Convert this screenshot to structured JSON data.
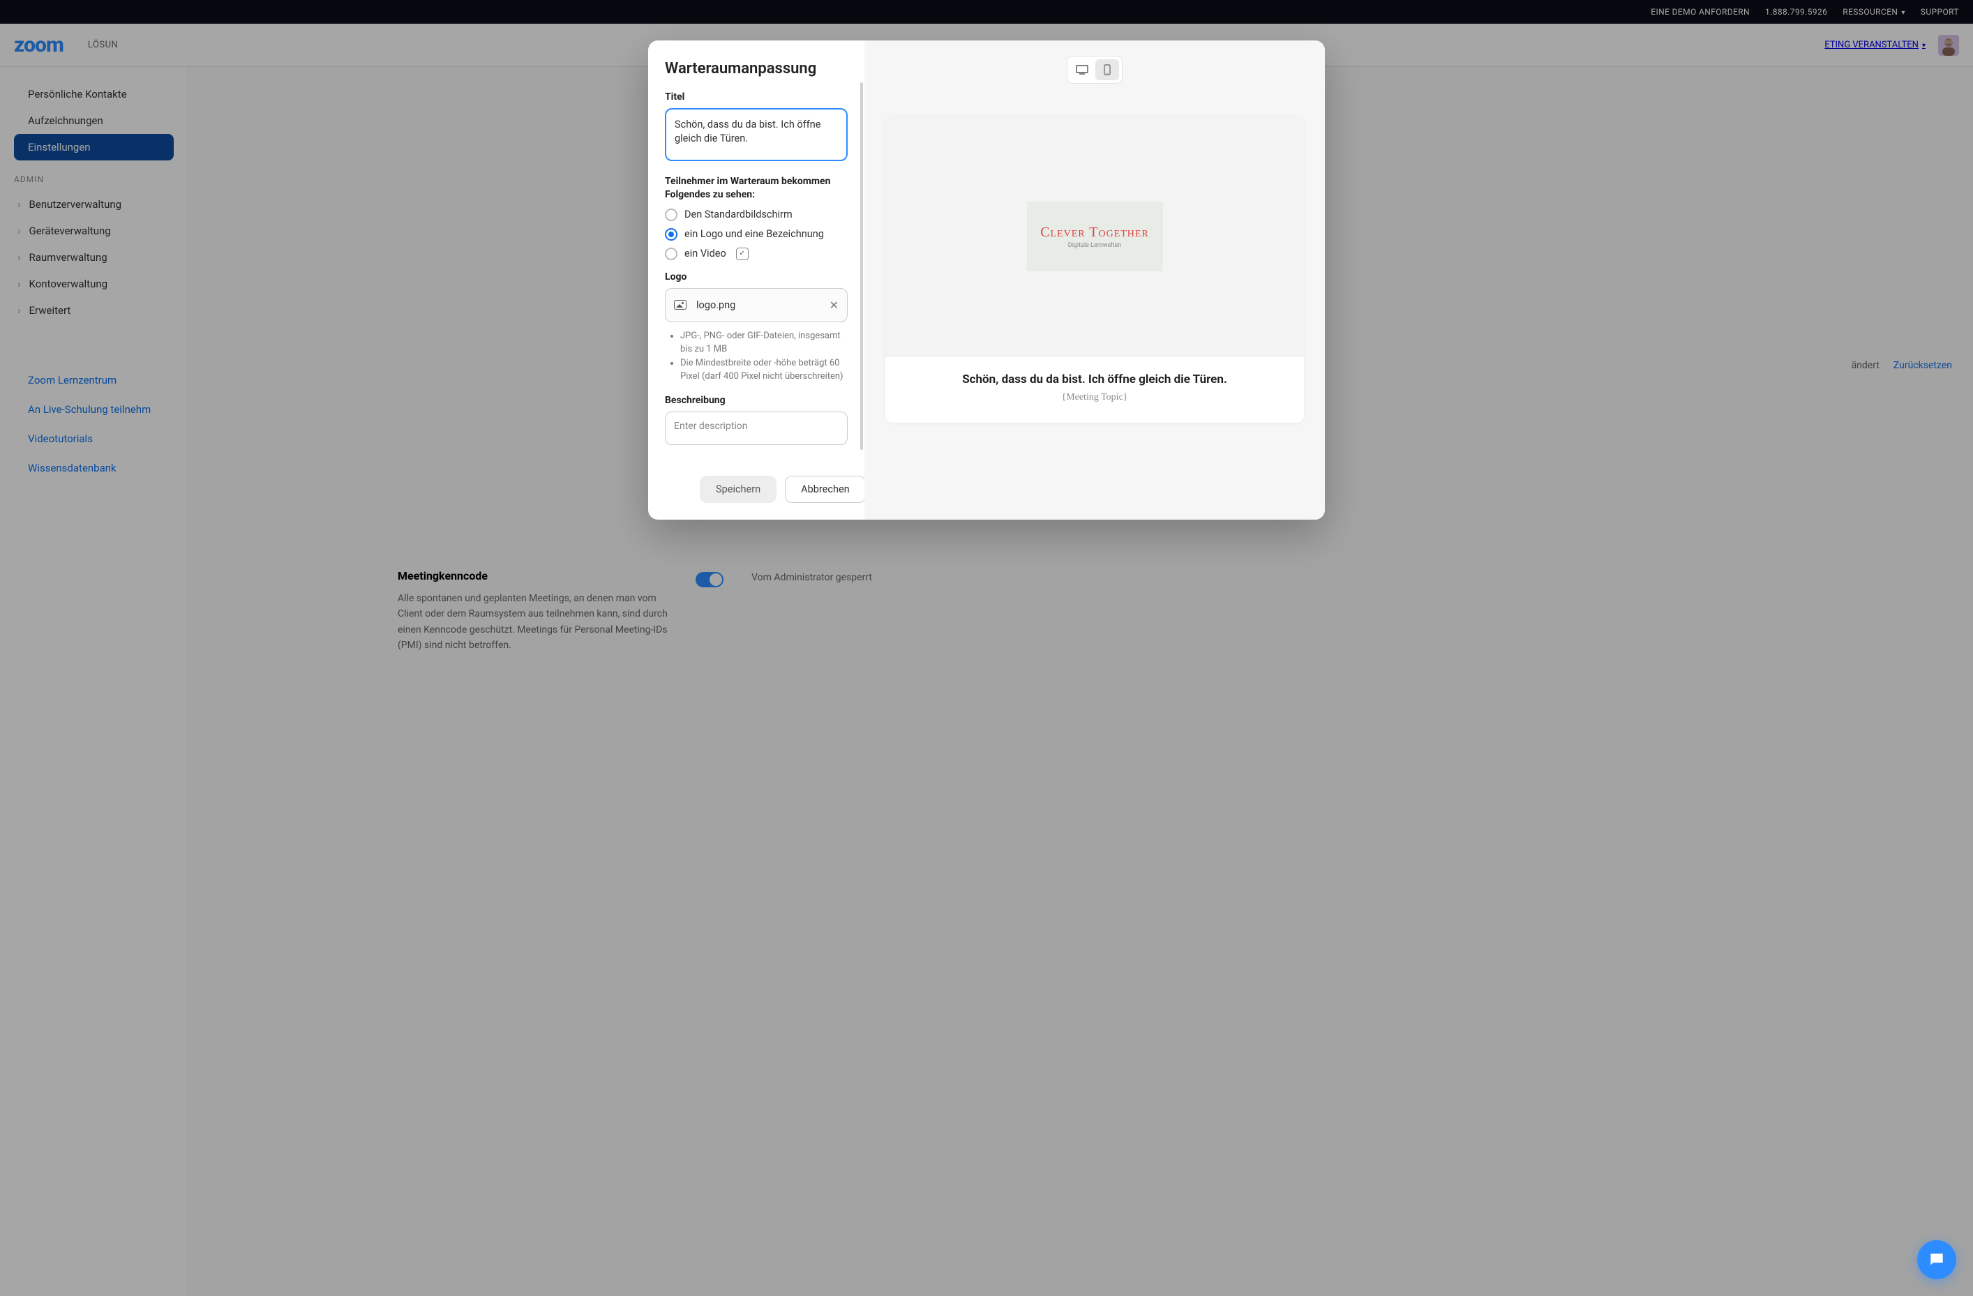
{
  "topbar": {
    "demo": "EINE DEMO ANFORDERN",
    "phone": "1.888.799.5926",
    "resources": "RESSOURCEN",
    "support": "SUPPORT"
  },
  "header": {
    "logo": "zoom",
    "nav": {
      "solutions": "LÖSUN"
    },
    "host": "ETING VERANSTALTEN"
  },
  "sidebar": {
    "items": [
      {
        "label": "Persönliche Kontakte",
        "active": false
      },
      {
        "label": "Aufzeichnungen",
        "active": false
      },
      {
        "label": "Einstellungen",
        "active": true
      }
    ],
    "admin_label": "ADMIN",
    "admin_items": [
      "Benutzerverwaltung",
      "Geräteverwaltung",
      "Raumverwaltung",
      "Kontoverwaltung",
      "Erweitert"
    ],
    "links": [
      "Zoom Lernzentrum",
      "An Live-Schulung teilnehm",
      "Videotutorials",
      "Wissensdatenbank"
    ]
  },
  "content_bg": {
    "modified": "ändert",
    "reset": "Zurücksetzen",
    "meeting_code_title": "Meetingkenncode",
    "meeting_code_desc": "Alle spontanen und geplanten Meetings, an denen man vom Client oder dem Raumsystem aus teilnehmen kann, sind durch einen Kenncode geschützt. Meetings für Personal Meeting-IDs (PMI) sind nicht betroffen.",
    "admin_locked": "Vom Administrator gesperrt"
  },
  "modal": {
    "title": "Warteraumanpassung",
    "titel_label": "Titel",
    "titel_value": "Schön, dass du da bist. Ich öffne gleich die Türen.",
    "participants_label": "Teilnehmer im Warteraum bekommen Folgendes zu sehen:",
    "radio_default": "Den Standardbildschirm",
    "radio_logo": "ein Logo und eine Bezeichnung",
    "radio_video": "ein Video",
    "logo_label": "Logo",
    "logo_filename": "logo.png",
    "hints": [
      "JPG-, PNG- oder GIF-Dateien, insgesamt bis zu 1 MB",
      "Die Mindestbreite oder -höhe beträgt 60 Pixel (darf 400 Pixel nicht überschreiten)"
    ],
    "desc_label": "Beschreibung",
    "desc_placeholder": "Enter description",
    "save": "Speichern",
    "cancel": "Abbrechen",
    "preview": {
      "brand_main": "Clever Together",
      "brand_sub": "Digitale Lernwelten",
      "title": "Schön, dass du da bist. Ich öffne gleich die Türen.",
      "topic": "{Meeting Topic}"
    }
  }
}
